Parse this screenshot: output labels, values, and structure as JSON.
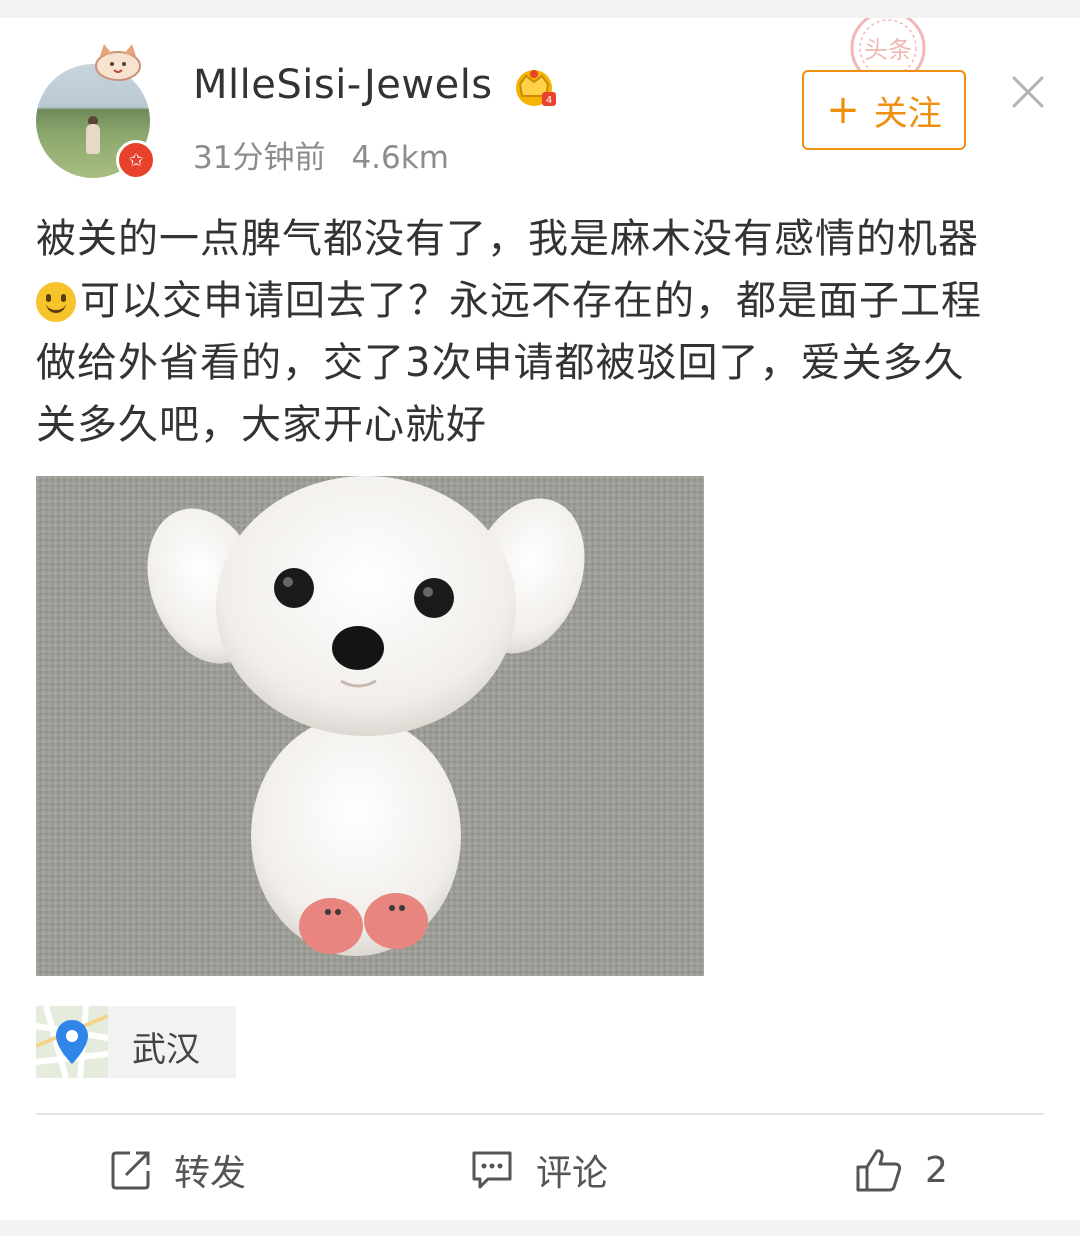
{
  "post": {
    "username": "MlleSisi-Jewels",
    "time_ago": "31分钟前",
    "distance": "4.6km",
    "follow_label": "关注",
    "text_line1": "被关的一点脾气都没有了，我是麻木没有感情的机器",
    "text_line2": "可以交申请回去了？永远不存在的，都是面子工程",
    "text_line3": "做给外省看的，交了3次申请都被驳回了，爱关多久",
    "text_line4": "关多久吧，大家开心就好",
    "location": "武汉",
    "stamp_text": "头条"
  },
  "actions": {
    "repost_label": "转发",
    "comment_label": "评论",
    "like_count": "2"
  },
  "colors": {
    "accent_orange": "#f08e0e",
    "badge_red": "#e8412c",
    "location_blue": "#2f86e8"
  },
  "icons": [
    "verified-badge-icon",
    "crown-icon",
    "plus-icon",
    "close-icon",
    "smile-emoji-icon",
    "map-pin-icon",
    "repost-icon",
    "comment-icon",
    "like-icon"
  ]
}
